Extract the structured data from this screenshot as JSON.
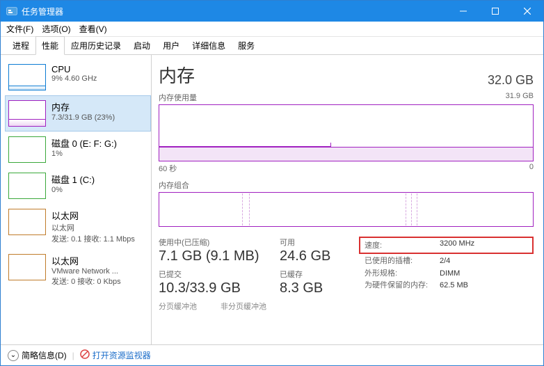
{
  "window": {
    "title": "任务管理器"
  },
  "menu": {
    "file": "文件(F)",
    "options": "选项(O)",
    "view": "查看(V)"
  },
  "tabs": [
    "进程",
    "性能",
    "应用历史记录",
    "启动",
    "用户",
    "详细信息",
    "服务"
  ],
  "sidebar": {
    "cpu": {
      "title": "CPU",
      "sub": "9% 4.60 GHz"
    },
    "memory": {
      "title": "内存",
      "sub": "7.3/31.9 GB (23%)"
    },
    "disk0": {
      "title": "磁盘 0 (E: F: G:)",
      "sub": "1%"
    },
    "disk1": {
      "title": "磁盘 1 (C:)",
      "sub": "0%"
    },
    "eth0": {
      "title": "以太网",
      "sub1": "以太网",
      "sub2": "发送: 0.1 接收: 1.1 Mbps"
    },
    "eth1": {
      "title": "以太网",
      "sub1": "VMware Network ...",
      "sub2": "发送: 0 接收: 0 Kbps"
    }
  },
  "main": {
    "title": "内存",
    "total": "32.0 GB",
    "usage_label": "内存使用量",
    "usage_max": "31.9 GB",
    "axis_left": "60 秒",
    "axis_right": "0",
    "comp_label": "内存组合",
    "stats": {
      "inuse_label": "使用中(已压缩)",
      "inuse_value": "7.1 GB (9.1 MB)",
      "avail_label": "可用",
      "avail_value": "24.6 GB",
      "commit_label": "已提交",
      "commit_value": "10.3/33.9 GB",
      "cached_label": "已缓存",
      "cached_value": "8.3 GB",
      "paged_label": "分页缓冲池",
      "nonpaged_label": "非分页缓冲池"
    },
    "meta": {
      "speed_k": "速度:",
      "speed_v": "3200 MHz",
      "slots_k": "已使用的插槽:",
      "slots_v": "2/4",
      "form_k": "外形规格:",
      "form_v": "DIMM",
      "reserved_k": "为硬件保留的内存:",
      "reserved_v": "62.5 MB"
    }
  },
  "footer": {
    "brief": "简略信息(D)",
    "monitor": "打开资源监视器"
  }
}
